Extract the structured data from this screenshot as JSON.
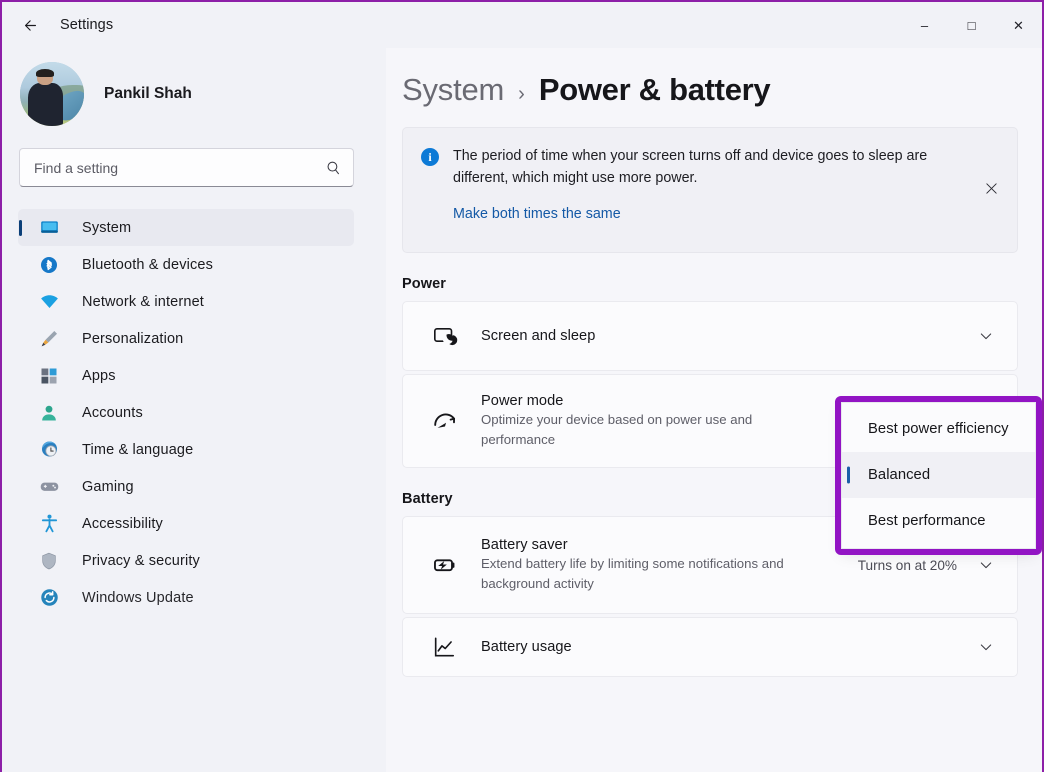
{
  "window": {
    "app_title": "Settings",
    "back_icon": "back-arrow-icon",
    "controls": {
      "minimize": "–",
      "maximize": "□",
      "close": "✕"
    }
  },
  "sidebar": {
    "profile": {
      "name": "Pankil Shah"
    },
    "search": {
      "placeholder": "Find a setting",
      "value": "",
      "icon": "search-icon"
    },
    "items": [
      {
        "label": "System",
        "icon": "monitor-icon",
        "selected": true
      },
      {
        "label": "Bluetooth & devices",
        "icon": "bluetooth-icon",
        "selected": false
      },
      {
        "label": "Network & internet",
        "icon": "wifi-icon",
        "selected": false
      },
      {
        "label": "Personalization",
        "icon": "paintbrush-icon",
        "selected": false
      },
      {
        "label": "Apps",
        "icon": "apps-grid-icon",
        "selected": false
      },
      {
        "label": "Accounts",
        "icon": "person-icon",
        "selected": false
      },
      {
        "label": "Time & language",
        "icon": "clock-globe-icon",
        "selected": false
      },
      {
        "label": "Gaming",
        "icon": "gamepad-icon",
        "selected": false
      },
      {
        "label": "Accessibility",
        "icon": "accessibility-icon",
        "selected": false
      },
      {
        "label": "Privacy & security",
        "icon": "shield-icon",
        "selected": false
      },
      {
        "label": "Windows Update",
        "icon": "windows-update-icon",
        "selected": false
      }
    ]
  },
  "main": {
    "breadcrumb": {
      "parent": "System",
      "separator": "›",
      "current": "Power & battery"
    },
    "info_banner": {
      "icon": "info-icon",
      "glyph": "i",
      "text": "The period of time when your screen turns off and device goes to sleep are different, which might use more power.",
      "link": "Make both times the same",
      "close_icon": "close-icon"
    },
    "sections": [
      {
        "title": "Power",
        "cards": [
          {
            "title": "Screen and sleep",
            "subtitle": "",
            "value": "",
            "icon": "screen-sleep-icon",
            "chevron": "chevron-down-icon"
          },
          {
            "title": "Power mode",
            "subtitle": "Optimize your device based on power use and performance",
            "value": "",
            "icon": "speedometer-icon",
            "chevron": "chevron-down-icon"
          }
        ]
      },
      {
        "title": "Battery",
        "cards": [
          {
            "title": "Battery saver",
            "subtitle": "Extend battery life by limiting some notifications and background activity",
            "value": "Turns on at 20%",
            "icon": "battery-saver-icon",
            "chevron": "chevron-down-icon"
          },
          {
            "title": "Battery usage",
            "subtitle": "",
            "value": "",
            "icon": "battery-usage-chart-icon",
            "chevron": "chevron-down-icon"
          }
        ]
      }
    ]
  },
  "power_mode_dropdown": {
    "options": [
      {
        "label": "Best power efficiency",
        "selected": false
      },
      {
        "label": "Balanced",
        "selected": true
      },
      {
        "label": "Best performance",
        "selected": false
      }
    ],
    "annotation_color": "#9214c4"
  }
}
